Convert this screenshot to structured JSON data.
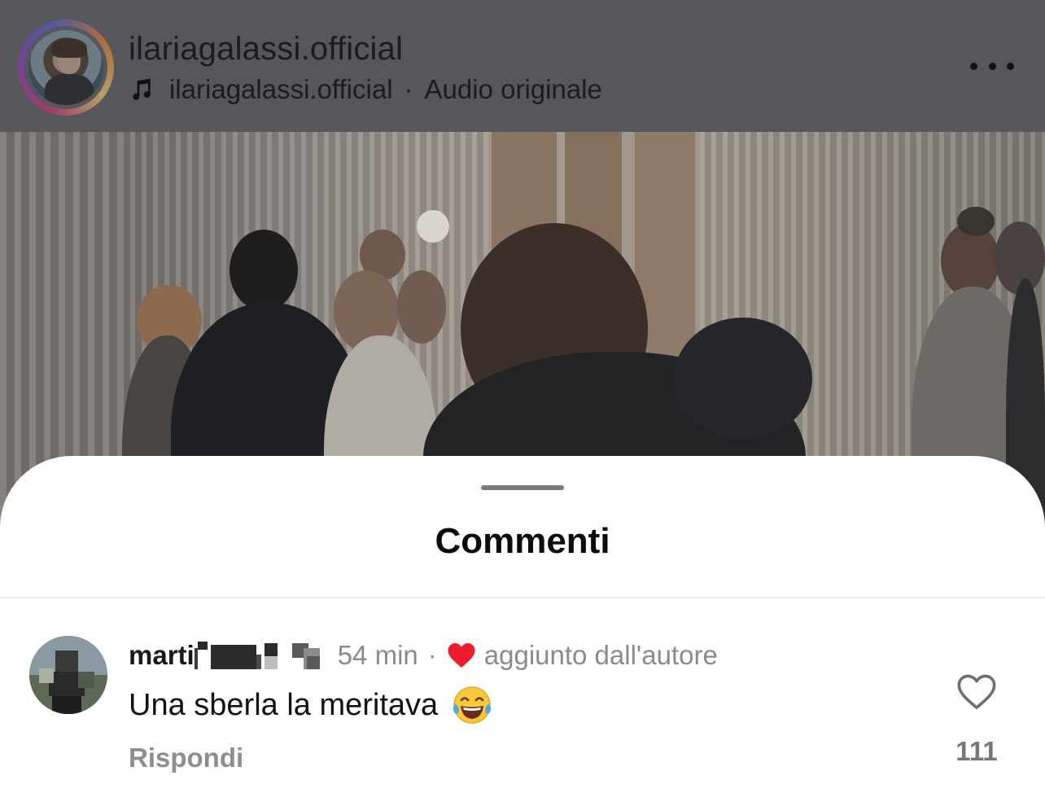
{
  "header": {
    "username": "ilariagalassi.official",
    "audio_author": "ilariagalassi.official",
    "audio_separator": "·",
    "audio_label": "Audio originale",
    "more_icon": "more-horizontal-icon",
    "music_icon": "music-note-icon"
  },
  "sheet": {
    "title": "Commenti"
  },
  "comment": {
    "author": "marti",
    "time": "54 min",
    "separator": "·",
    "liked_by_author_label": "aggiunto dall'autore",
    "text": "Una sberla la meritava",
    "emoji": "😂",
    "reply_label": "Rispondi",
    "like_count": "111",
    "like_icon": "heart-outline-icon",
    "author_heart_color": "#ee1d2e"
  }
}
